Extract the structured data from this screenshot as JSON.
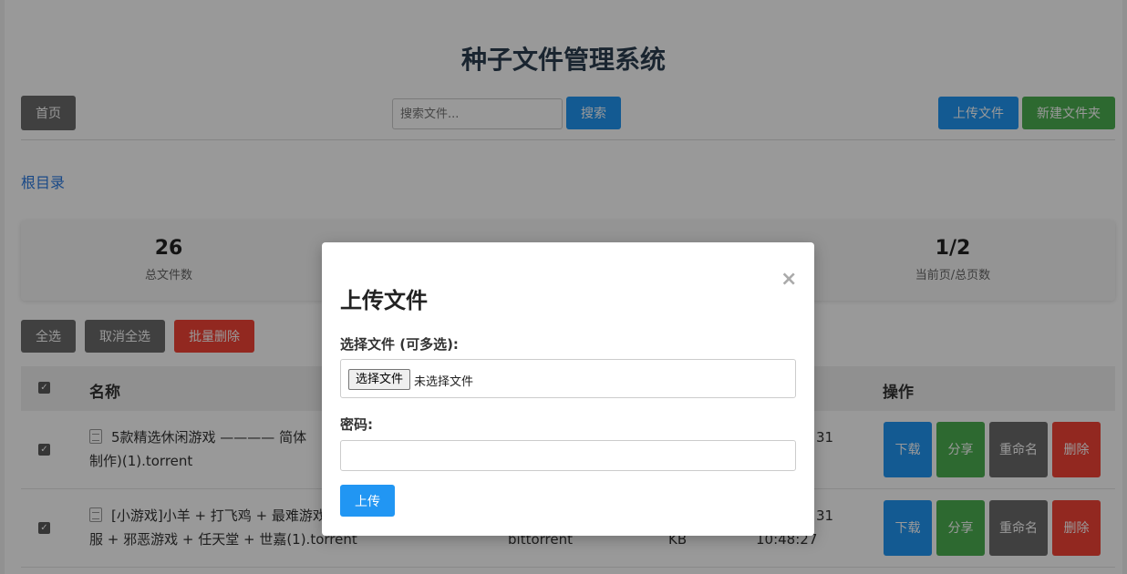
{
  "header": {
    "title": "种子文件管理系统"
  },
  "toolbar": {
    "home_label": "首页",
    "search_placeholder": "搜索文件...",
    "search_label": "搜索",
    "upload_label": "上传文件",
    "new_folder_label": "新建文件夹"
  },
  "breadcrumb": {
    "root_label": "根目录"
  },
  "stats": [
    {
      "value": "26",
      "label": "总文件数"
    },
    {
      "value": "1/2",
      "label": "当前页/总页数"
    }
  ],
  "bulk": {
    "select_all": "全选",
    "deselect_all": "取消全选",
    "bulk_delete": "批量删除"
  },
  "table": {
    "headers": {
      "name": "名称",
      "actions": "操作"
    },
    "rows": [
      {
        "name_line1": "5款精选休闲游戏 ———— 简体",
        "name_line2": "制作)(1).torrent",
        "date_line1": "31",
        "date_line2": "",
        "type": "",
        "size": ""
      },
      {
        "name_line1": "[小游戏]小羊 + 打飞鸡 + 最难游戏",
        "name_line2": "服 + 邪恶游戏 + 任天堂 + 世嘉(1).torrent",
        "date_line1": "31",
        "date_line2": "10:48:27",
        "type": "bittorrent",
        "size": "KB"
      }
    ],
    "actions": {
      "download": "下载",
      "share": "分享",
      "rename": "重命名",
      "delete": "删除"
    }
  },
  "modal": {
    "title": "上传文件",
    "close_glyph": "×",
    "file_label": "选择文件 (可多选):",
    "file_button": "选择文件",
    "file_status": "未选择文件",
    "password_label": "密码:",
    "submit_label": "上传"
  },
  "colors": {
    "primary": "#2196f3",
    "success": "#4caf50",
    "danger": "#f44336",
    "neutral": "#6b6b6b"
  }
}
